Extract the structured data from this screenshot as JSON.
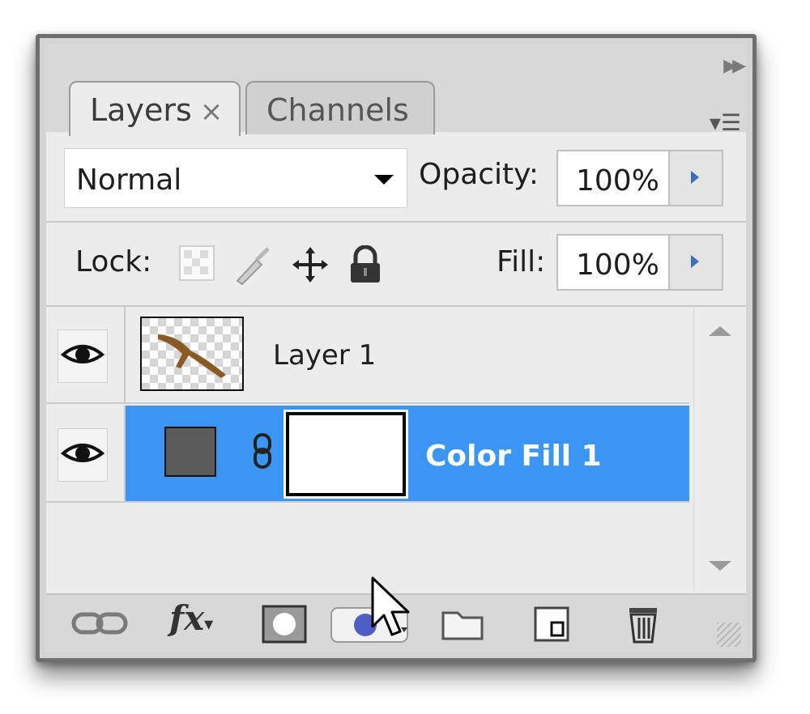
{
  "tabs": [
    {
      "label": "Layers",
      "close": "×"
    },
    {
      "label": "Channels"
    }
  ],
  "blend_mode": {
    "selected": "Normal"
  },
  "opacity": {
    "label": "Opacity:",
    "value": "100%"
  },
  "lock": {
    "label": "Lock:"
  },
  "fill": {
    "label": "Fill:",
    "value": "100%"
  },
  "layers": [
    {
      "name": "Layer 1",
      "visible": true,
      "selected": false
    },
    {
      "name": "Color Fill 1",
      "visible": true,
      "selected": true,
      "swatch_color": "#5a5a5a"
    }
  ],
  "footer_icons": [
    "link-layers-icon",
    "fx-icon",
    "add-mask-icon",
    "new-adjustment-layer-icon",
    "new-group-icon",
    "new-layer-icon",
    "delete-layer-icon"
  ],
  "colors": {
    "selection": "#3a96f2",
    "panel_bg": "#ececec"
  }
}
